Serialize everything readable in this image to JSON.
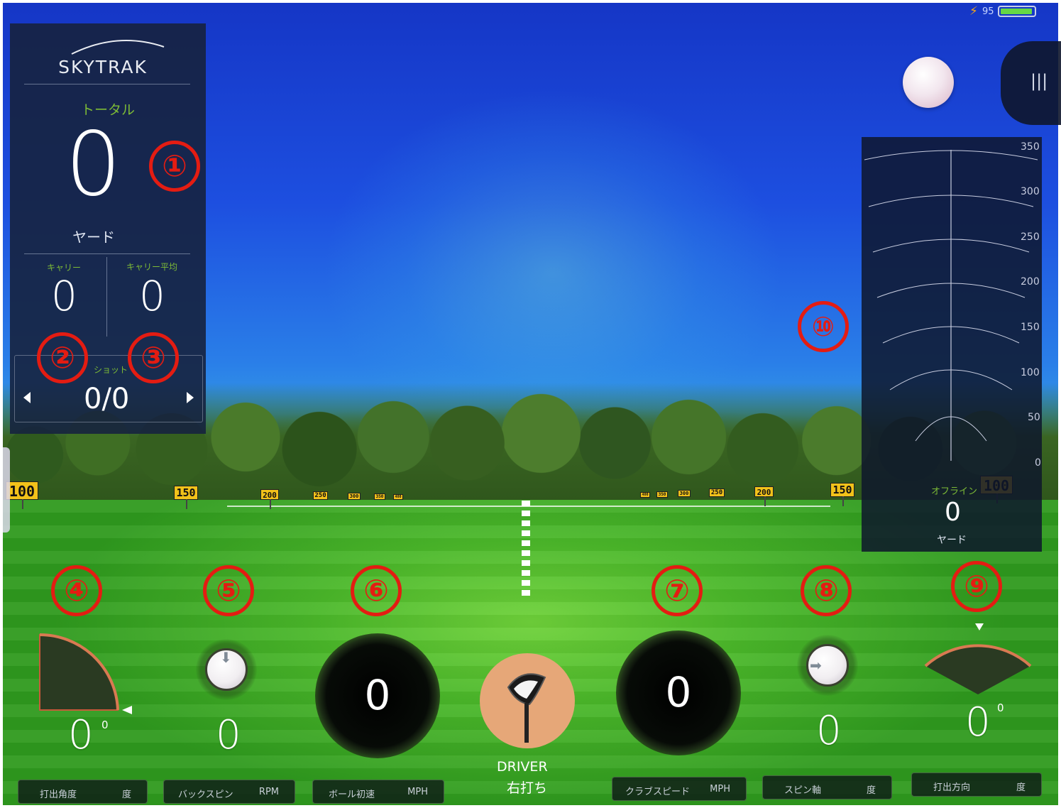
{
  "status": {
    "battery_level": "95",
    "battery_fraction": 0.95,
    "bolt_icon": "bolt-icon"
  },
  "left_panel": {
    "logo": "SKYTRAK",
    "total_label": "トータル",
    "total_value": "0",
    "total_unit": "ヤード",
    "carry_label": "キャリー",
    "carry_value": "0",
    "carry_avg_label": "キャリー平均",
    "carry_avg_value": "0",
    "shots_label": "ショット",
    "shots_value": "0/0"
  },
  "right_panel": {
    "scale_ticks": [
      "350",
      "300",
      "250",
      "200",
      "150",
      "100",
      "50",
      "0"
    ],
    "offline_label": "オフライン",
    "offline_value": "0",
    "offline_unit": "ヤード"
  },
  "range_signs": [
    "100",
    "150",
    "200",
    "250",
    "300",
    "350",
    "400",
    "400",
    "350",
    "300",
    "250",
    "200",
    "150",
    "100"
  ],
  "gauges": {
    "launch_angle": {
      "value": "0",
      "sup": "0"
    },
    "backspin": {
      "value": "0"
    },
    "ball_speed": {
      "value": "0"
    },
    "club_speed": {
      "value": "0"
    },
    "spin_axis": {
      "value": "0"
    },
    "launch_direction": {
      "value": "0",
      "sup": "0"
    }
  },
  "club": {
    "name": "DRIVER",
    "hand": "右打ち"
  },
  "bottom_buttons": [
    {
      "label": "打出角度",
      "unit": "度"
    },
    {
      "label": "バックスピン",
      "unit": "RPM"
    },
    {
      "label": "ボール初速",
      "unit": "MPH"
    },
    {
      "label": "クラブスピード",
      "unit": "MPH"
    },
    {
      "label": "スピン軸",
      "unit": "度"
    },
    {
      "label": "打出方向",
      "unit": "度"
    }
  ],
  "callouts": [
    "①",
    "②",
    "③",
    "④",
    "⑤",
    "⑥",
    "⑦",
    "⑧",
    "⑨",
    "⑩"
  ],
  "colors": {
    "callout": "#e41c12",
    "accent_green": "#7dbb36",
    "panel": "#16223e",
    "club_circle": "#e6a778"
  }
}
